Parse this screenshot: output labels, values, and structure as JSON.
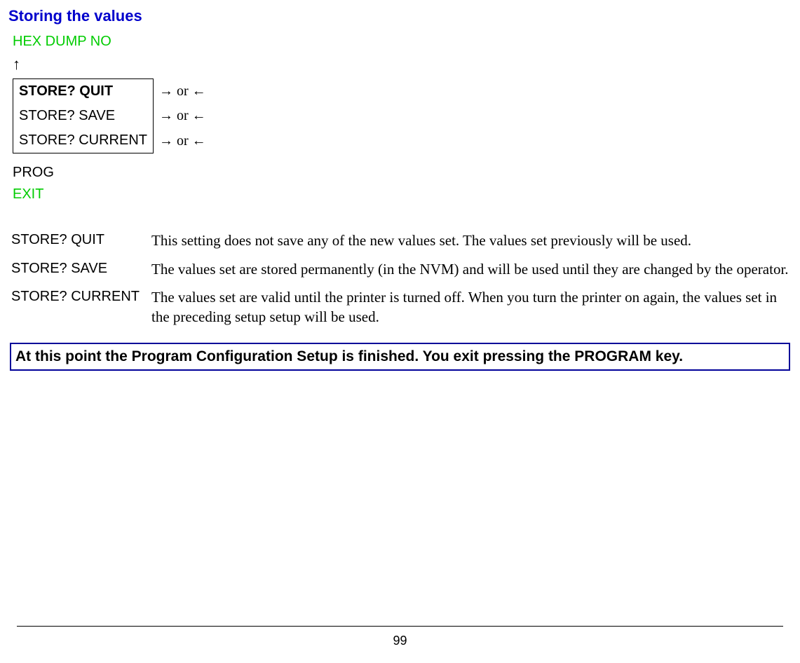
{
  "heading": "Storing the values",
  "menu": {
    "top_green": "HEX DUMP NO",
    "up_arrow": "↑",
    "row1_label": "STORE? QUIT",
    "row2_label": "STORE? SAVE",
    "row3_label": "STORE? CURRENT",
    "arr_text": "→ or ←",
    "prog": "PROG",
    "exit": "EXIT"
  },
  "descriptions": {
    "quit_label": "STORE? QUIT",
    "quit_text": "This setting does not save any of the new values set. The values set previously will be used.",
    "save_label": "STORE? SAVE",
    "save_text": "The values set are stored permanently (in the NVM) and will be used until they are changed by the operator.",
    "current_label": "STORE? CURRENT",
    "current_text": "The values set are valid until the printer is turned off. When you turn the printer on again, the values set in the preceding setup setup will be used."
  },
  "note": "At this point the Program Configuration Setup is finished. You exit pressing the PROGRAM  key.",
  "page_number": "99"
}
